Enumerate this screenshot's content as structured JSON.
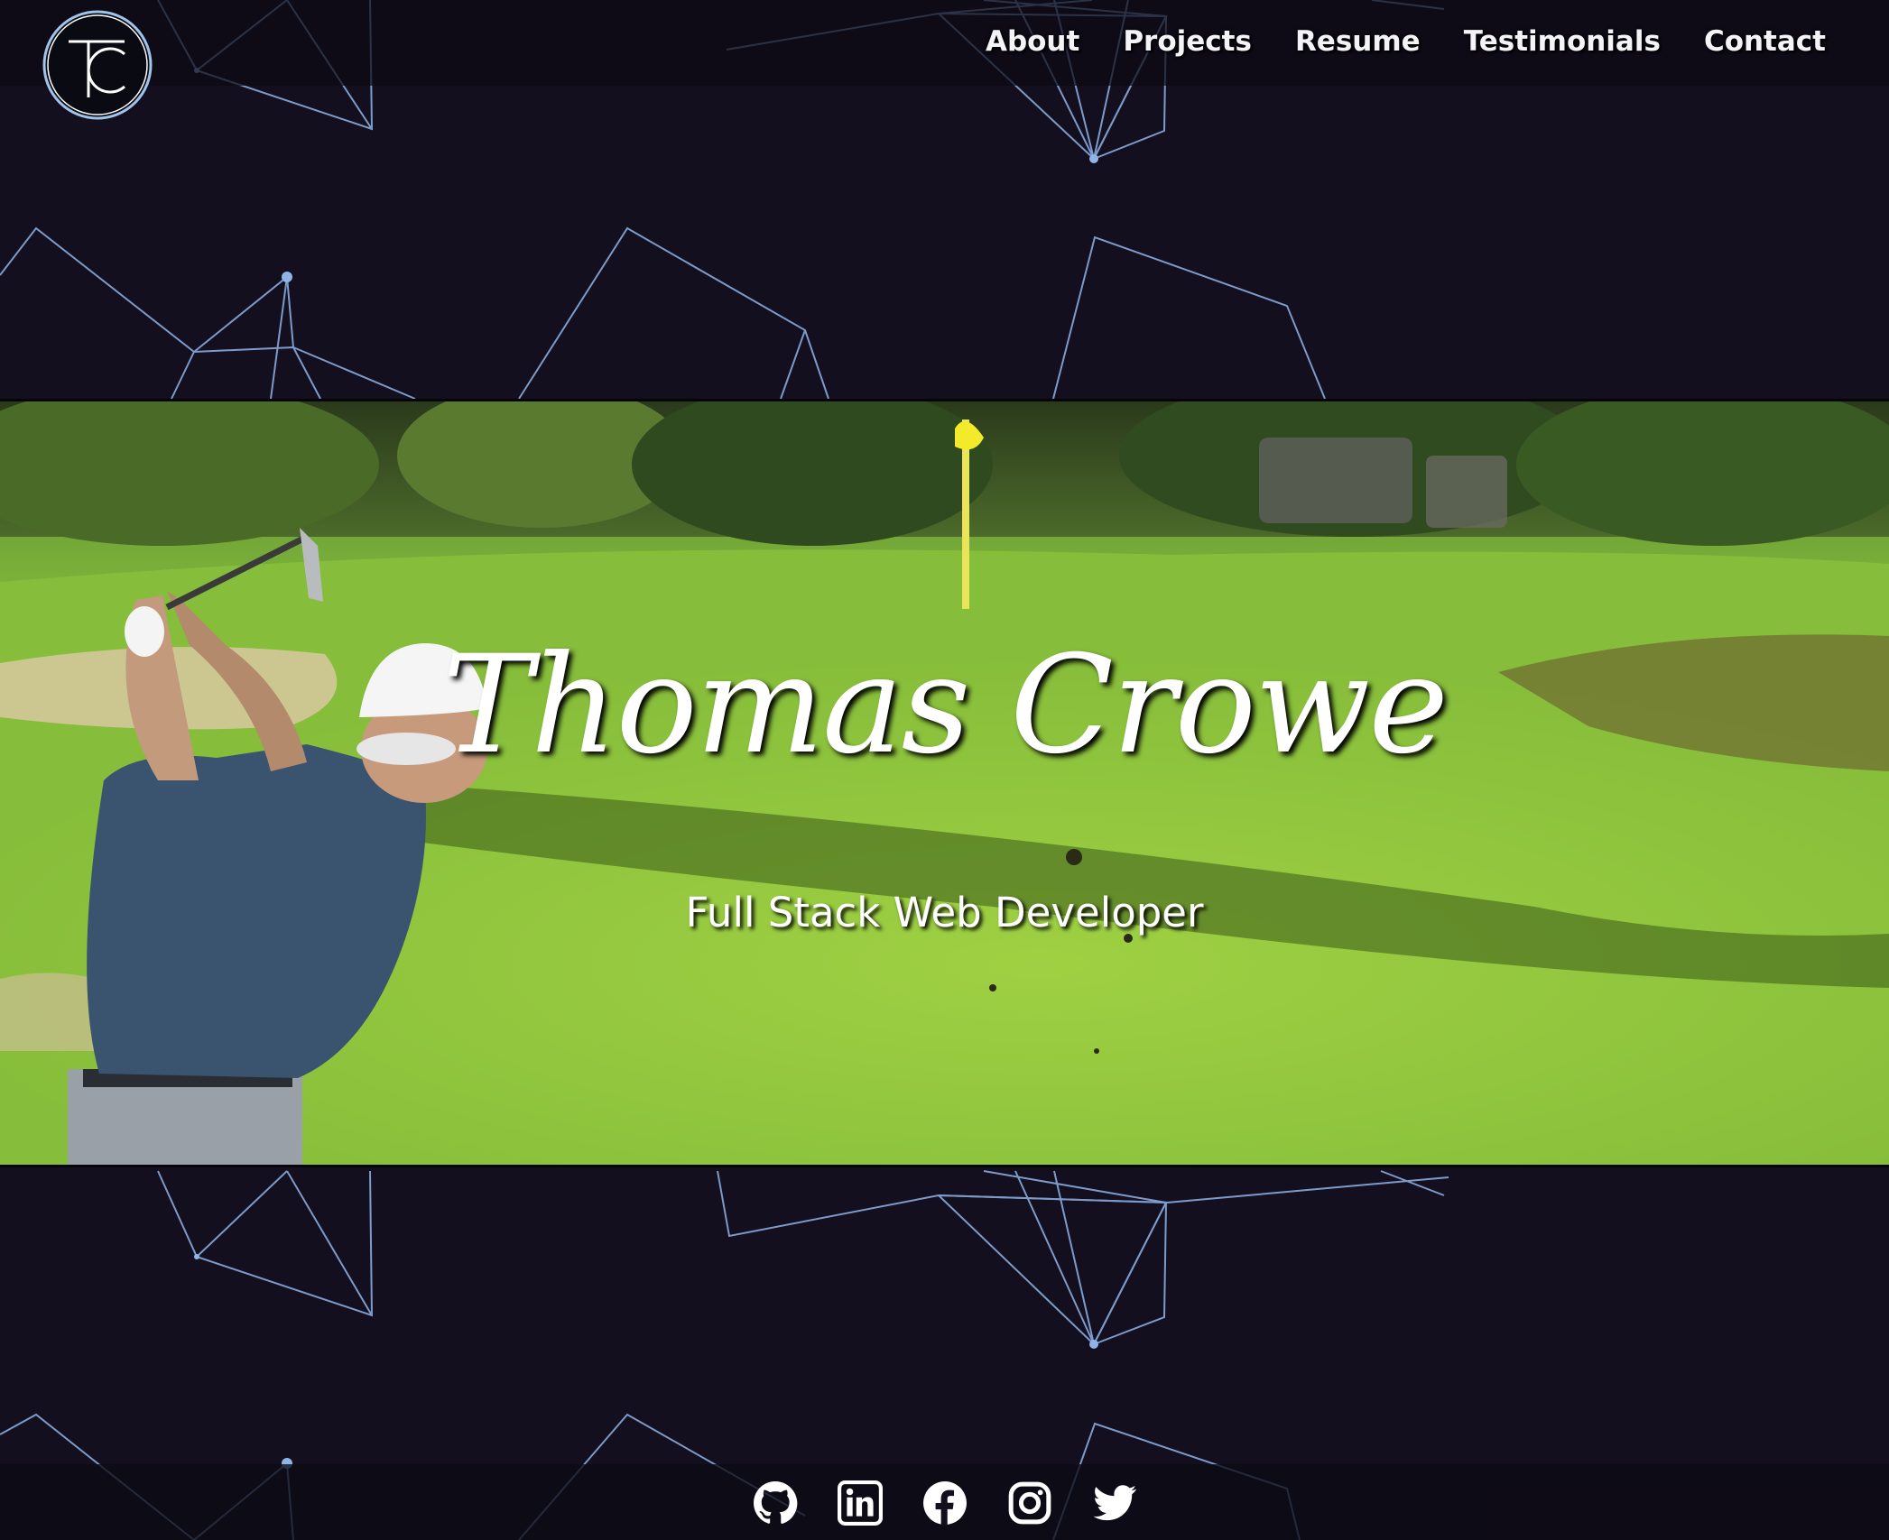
{
  "header": {
    "logo_icon": "tc-monogram-logo",
    "nav": [
      {
        "label": "About"
      },
      {
        "label": "Projects"
      },
      {
        "label": "Resume"
      },
      {
        "label": "Testimonials"
      },
      {
        "label": "Contact"
      }
    ]
  },
  "hero": {
    "name": "Thomas Crowe",
    "subtitle": "Full Stack Web Developer",
    "image": "golfer-swinging-on-fairway"
  },
  "footer": {
    "social": [
      {
        "icon": "github-icon"
      },
      {
        "icon": "linkedin-icon"
      },
      {
        "icon": "facebook-icon"
      },
      {
        "icon": "instagram-icon"
      },
      {
        "icon": "twitter-icon"
      }
    ]
  },
  "colors": {
    "background": "#130f1e",
    "network_lines": "#8fb4e8",
    "text": "#ffffff"
  }
}
